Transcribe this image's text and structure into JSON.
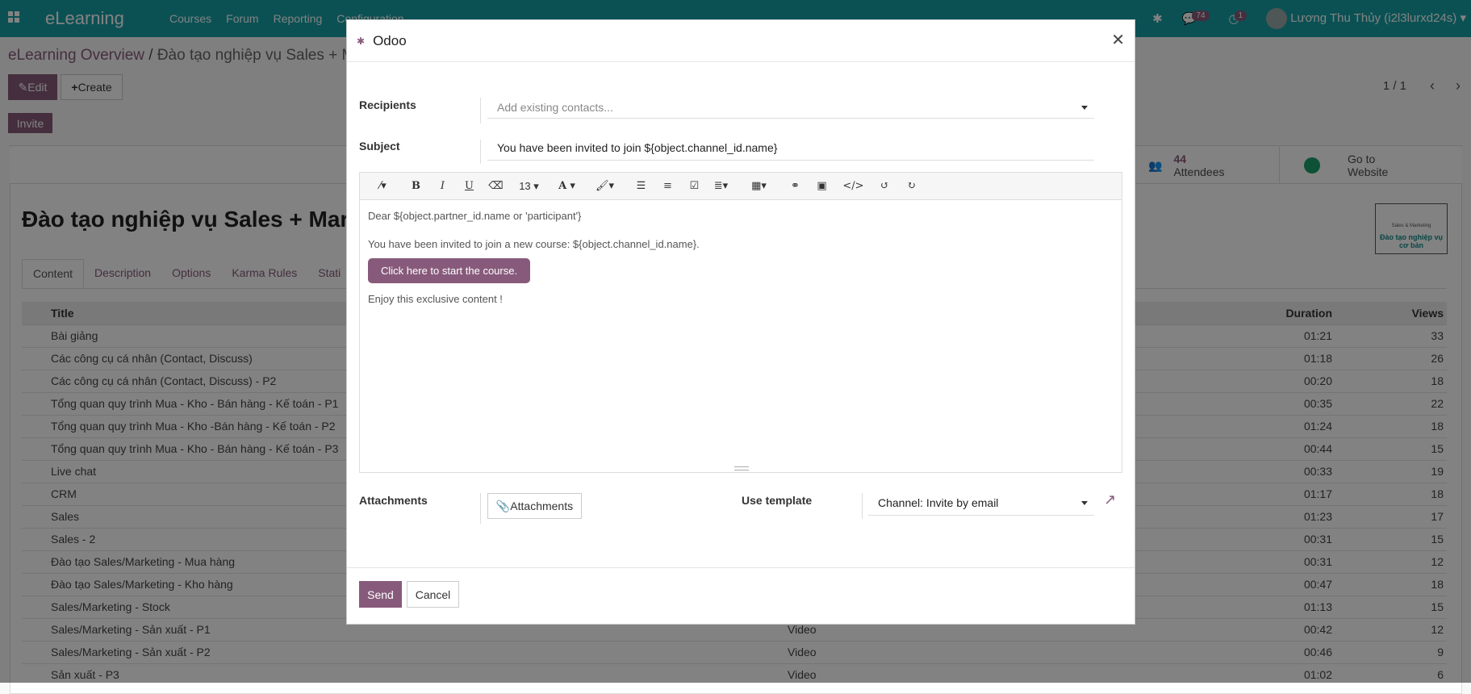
{
  "navbar": {
    "app": "eLearning",
    "menu": [
      "Courses",
      "Forum",
      "Reporting",
      "Configuration"
    ],
    "messages_count": "74",
    "activities_count": "1",
    "user": "Lương Thu Thủy (i2l3lurxd24s)"
  },
  "breadcrumb": {
    "parent": "eLearning Overview",
    "separator": "/",
    "current": "Đào tạo nghiệp vụ Sales + Mar"
  },
  "toolbar": {
    "edit": "Edit",
    "create": "Create",
    "invite": "Invite",
    "pager": "1 / 1"
  },
  "stats": {
    "attendees_count": "44",
    "attendees_label": "Attendees",
    "website_label": "Go to Website"
  },
  "record": {
    "title": "Đào tạo nghiệp vụ Sales + Marke",
    "cover_text": "Đào tạo nghiệp vụ cơ bản",
    "cover_sub": "Sales & Marketing"
  },
  "tabs": [
    "Content",
    "Description",
    "Options",
    "Karma Rules",
    "Stati"
  ],
  "table": {
    "headers": {
      "title": "Title",
      "duration": "Duration",
      "views": "Views"
    },
    "rows": [
      {
        "title": "Bài giảng",
        "type": "",
        "duration": "01:21",
        "views": "33"
      },
      {
        "title": "Các công cụ cá nhân (Contact, Discuss)",
        "type": "",
        "duration": "01:18",
        "views": "26"
      },
      {
        "title": "Các công cụ cá nhân (Contact, Discuss) - P2",
        "type": "",
        "duration": "00:20",
        "views": "18"
      },
      {
        "title": "Tổng quan quy trình Mua - Kho - Bán hàng - Kế toán - P1",
        "type": "",
        "duration": "00:35",
        "views": "22"
      },
      {
        "title": "Tổng quan quy trình Mua - Kho -Bán hàng - Kế toán - P2",
        "type": "",
        "duration": "01:24",
        "views": "18"
      },
      {
        "title": "Tổng quan quy trình Mua - Kho - Bán hàng - Kế toán - P3",
        "type": "",
        "duration": "00:44",
        "views": "15"
      },
      {
        "title": "Live chat",
        "type": "",
        "duration": "00:33",
        "views": "19"
      },
      {
        "title": "CRM",
        "type": "",
        "duration": "01:17",
        "views": "18"
      },
      {
        "title": "Sales",
        "type": "",
        "duration": "01:23",
        "views": "17"
      },
      {
        "title": "Sales - 2",
        "type": "",
        "duration": "00:31",
        "views": "15"
      },
      {
        "title": "Đào tạo Sales/Marketing - Mua hàng",
        "type": "",
        "duration": "00:31",
        "views": "12"
      },
      {
        "title": "Đào tạo Sales/Marketing - Kho hàng",
        "type": "",
        "duration": "00:47",
        "views": "18"
      },
      {
        "title": "Sales/Marketing - Stock",
        "type": "",
        "duration": "01:13",
        "views": "15"
      },
      {
        "title": "Sales/Marketing - Sản xuất - P1",
        "type": "Video",
        "duration": "00:42",
        "views": "12"
      },
      {
        "title": "Sales/Marketing - Sản xuất - P2",
        "type": "Video",
        "duration": "00:46",
        "views": "9"
      },
      {
        "title": "Sản xuất - P3",
        "type": "Video",
        "duration": "01:02",
        "views": "6"
      }
    ]
  },
  "dialog": {
    "title": "Odoo",
    "recipients_label": "Recipients",
    "recipients_placeholder": "Add existing contacts...",
    "subject_label": "Subject",
    "subject_value": "You have been invited to join ${object.channel_id.name}",
    "font_size": "13",
    "body": {
      "line1": "Dear ${object.partner_id.name or 'participant'}",
      "line2": "You have been invited to join a new course: ${object.channel_id.name}.",
      "button": "Click here to start the course.",
      "line3": "Enjoy this exclusive content !"
    },
    "attachments_label": "Attachments",
    "attachments_button": "Attachments",
    "template_label": "Use template",
    "template_value": "Channel: Invite by email",
    "send": "Send",
    "cancel": "Cancel"
  },
  "colors": {
    "brand": "#875a7b",
    "navbar": "#17a0a6"
  }
}
